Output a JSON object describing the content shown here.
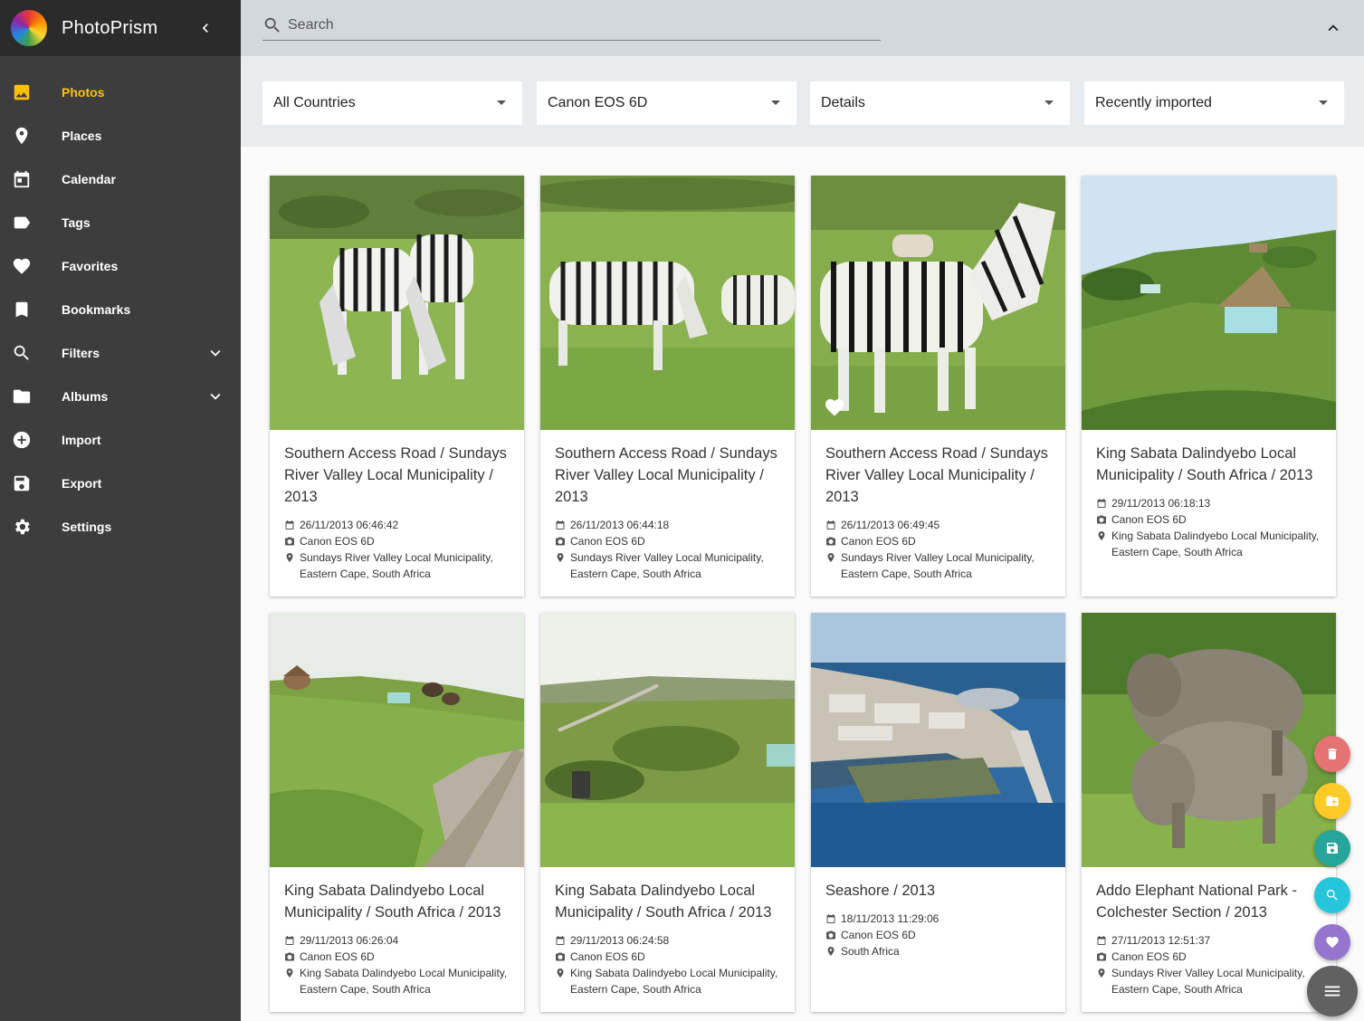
{
  "app": {
    "title": "PhotoPrism"
  },
  "sidebar": {
    "items": [
      {
        "label": "Photos",
        "icon": "photo-icon",
        "active": true
      },
      {
        "label": "Places",
        "icon": "place-pin-icon"
      },
      {
        "label": "Calendar",
        "icon": "calendar-icon"
      },
      {
        "label": "Tags",
        "icon": "label-tag-icon"
      },
      {
        "label": "Favorites",
        "icon": "heart-icon"
      },
      {
        "label": "Bookmarks",
        "icon": "bookmark-icon"
      },
      {
        "label": "Filters",
        "icon": "search-icon",
        "expandable": true
      },
      {
        "label": "Albums",
        "icon": "folder-icon",
        "expandable": true
      },
      {
        "label": "Import",
        "icon": "add-circle-icon"
      },
      {
        "label": "Export",
        "icon": "save-icon"
      },
      {
        "label": "Settings",
        "icon": "gear-icon"
      }
    ]
  },
  "search": {
    "placeholder": "Search"
  },
  "filters": {
    "country": "All Countries",
    "camera": "Canon EOS 6D",
    "view": "Details",
    "sort": "Recently imported"
  },
  "photos": [
    {
      "title": "Southern Access Road / Sundays River Valley Local Municipality / 2013",
      "date": "26/11/2013 06:46:42",
      "camera": "Canon EOS 6D",
      "location": "Sundays River Valley Local Municipality, Eastern Cape, South Africa",
      "scene": "zebras-grazing"
    },
    {
      "title": "Southern Access Road / Sundays River Valley Local Municipality / 2013",
      "date": "26/11/2013 06:44:18",
      "camera": "Canon EOS 6D",
      "location": "Sundays River Valley Local Municipality, Eastern Cape, South Africa",
      "scene": "zebras-field"
    },
    {
      "title": "Southern Access Road / Sundays River Valley Local Municipality / 2013",
      "date": "26/11/2013 06:49:45",
      "camera": "Canon EOS 6D",
      "location": "Sundays River Valley Local Municipality, Eastern Cape, South Africa",
      "scene": "zebra-standing",
      "favorite": true
    },
    {
      "title": "King Sabata Dalindyebo Local Municipality / South Africa / 2013",
      "date": "29/11/2013 06:18:13",
      "camera": "Canon EOS 6D",
      "location": "King Sabata Dalindyebo Local Municipality, Eastern Cape, South Africa",
      "scene": "hut-hill"
    },
    {
      "title": "King Sabata Dalindyebo Local Municipality / South Africa / 2013",
      "date": "29/11/2013 06:26:04",
      "camera": "Canon EOS 6D",
      "location": "King Sabata Dalindyebo Local Municipality, Eastern Cape, South Africa",
      "scene": "dirt-road"
    },
    {
      "title": "King Sabata Dalindyebo Local Municipality / South Africa / 2013",
      "date": "29/11/2013 06:24:58",
      "camera": "Canon EOS 6D",
      "location": "King Sabata Dalindyebo Local Municipality, Eastern Cape, South Africa",
      "scene": "valley-road"
    },
    {
      "title": "Seashore / 2013",
      "date": "18/11/2013 11:29:06",
      "camera": "Canon EOS 6D",
      "location": "South Africa",
      "scene": "harbour-aerial"
    },
    {
      "title": "Addo Elephant National Park - Colchester Section / 2013",
      "date": "27/11/2013 12:51:37",
      "camera": "Canon EOS 6D",
      "location": "Sundays River Valley Local Municipality, Eastern Cape, South Africa",
      "scene": "warthogs"
    }
  ],
  "actions": {
    "delete": {
      "icon": "delete-icon",
      "color": "#e57373"
    },
    "add_to_album": {
      "icon": "folder-add-icon",
      "color": "#ffca28"
    },
    "download": {
      "icon": "save-icon",
      "color": "#26a69a"
    },
    "edit": {
      "icon": "zoom-edit-icon",
      "color": "#26c6da"
    },
    "like": {
      "icon": "heart-icon",
      "color": "#9575cd"
    },
    "menu": {
      "icon": "menu-icon",
      "color": "#616161"
    }
  },
  "colors": {
    "accent": "#ffc107",
    "sidebar_bg": "#3d3d3d",
    "toolbar_bg": "#d3d8dd"
  }
}
